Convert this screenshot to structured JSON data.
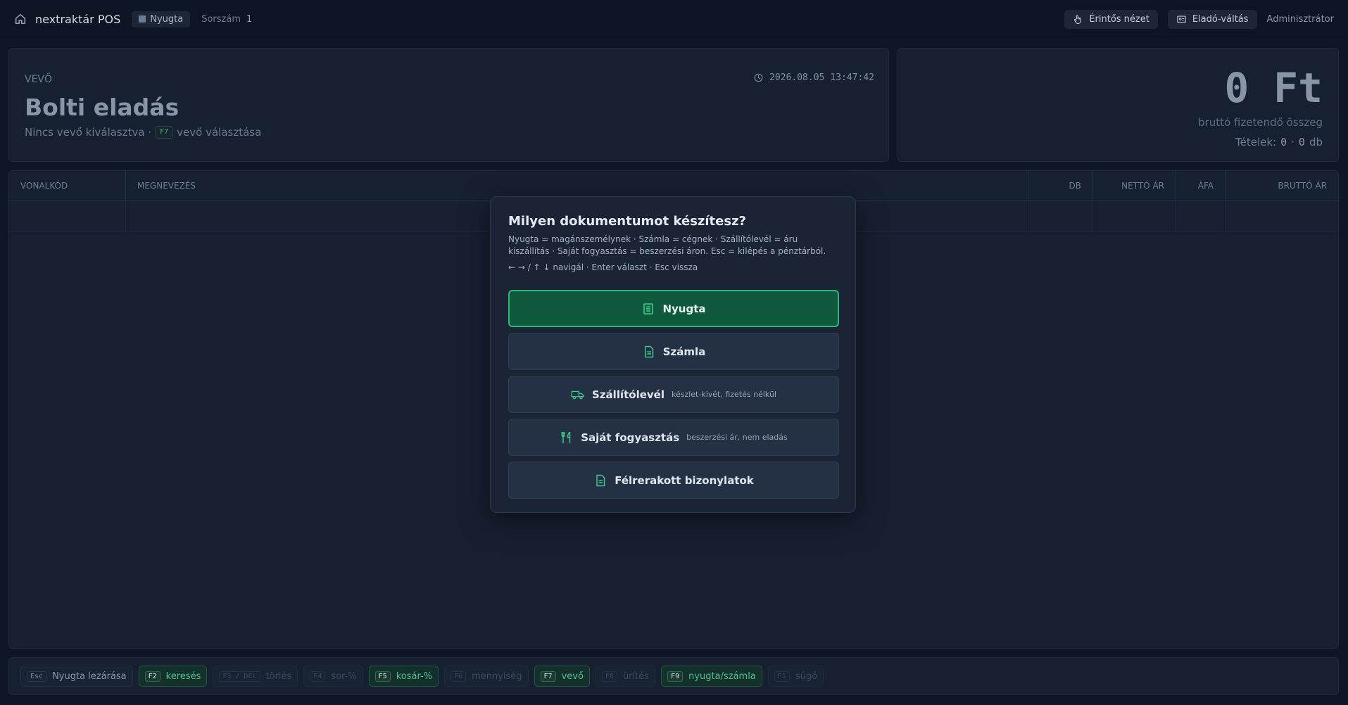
{
  "header": {
    "app_name": "nextraktár POS",
    "doc_type": "Nyugta",
    "serial_label": "Sorszám",
    "serial_value": "1",
    "touch_view_label": "Érintős nézet",
    "seller_switch_label": "Eladó-váltás",
    "user": "Adminisztrátor"
  },
  "buyer": {
    "tag": "Vevő",
    "name": "Bolti eladás",
    "no_customer": "Nincs vevő kiválasztva ·",
    "select_key": "F7",
    "select_label": "vevő választása",
    "date": "2026.08.05",
    "time": "13:47:42"
  },
  "total": {
    "amount": "0 Ft",
    "caption": "bruttó fizetendő összeg",
    "items_label": "Tételek:",
    "items_count": "0",
    "separator": "·",
    "qty": "0",
    "qty_unit": "db"
  },
  "table": {
    "columns": [
      "Vonalkód",
      "Megnevezés",
      "DB",
      "Nettó ár",
      "ÁFA",
      "Bruttó ár"
    ]
  },
  "modal": {
    "title": "Milyen dokumentumot készítesz?",
    "description": "Nyugta = magánszemélynek · Számla = cégnek · Szállítólevél = áru kiszállítás · Saját fogyasztás = beszerzési áron. Esc = kilépés a pénztárból.",
    "hint": "← → / ↑ ↓ navigál · Enter választ · Esc vissza",
    "options": [
      {
        "label": "Nyugta",
        "sub": "",
        "icon": "receipt-icon",
        "selected": true
      },
      {
        "label": "Számla",
        "sub": "",
        "icon": "invoice-icon",
        "selected": false
      },
      {
        "label": "Szállítólevél",
        "sub": "készlet-kivét, fizetés nélkül",
        "icon": "truck-icon",
        "selected": false
      },
      {
        "label": "Saját fogyasztás",
        "sub": "beszerzési ár, nem eladás",
        "icon": "utensils-icon",
        "selected": false
      },
      {
        "label": "Félrerakott bizonylatok",
        "sub": "",
        "icon": "document-icon",
        "selected": false
      }
    ]
  },
  "footer": {
    "keys": [
      {
        "key": "Esc",
        "label": "Nyugta lezárása",
        "state": "mid"
      },
      {
        "key": "F2",
        "label": "keresés",
        "state": "on"
      },
      {
        "key": "F3 / DEL",
        "label": "törlés",
        "state": "dim"
      },
      {
        "key": "F4",
        "label": "sor-%",
        "state": "dim"
      },
      {
        "key": "F5",
        "label": "kosár-%",
        "state": "on"
      },
      {
        "key": "F6",
        "label": "mennyiség",
        "state": "dim"
      },
      {
        "key": "F7",
        "label": "vevő",
        "state": "on"
      },
      {
        "key": "F8",
        "label": "ürítés",
        "state": "dim"
      },
      {
        "key": "F9",
        "label": "nyugta/számla",
        "state": "on"
      },
      {
        "key": "F1",
        "label": "súgó",
        "state": "dim"
      }
    ]
  },
  "colors": {
    "background": "#0f1726",
    "panel": "#162031",
    "accent": "#2fb67a",
    "selected_option": "#0f5a3c"
  }
}
